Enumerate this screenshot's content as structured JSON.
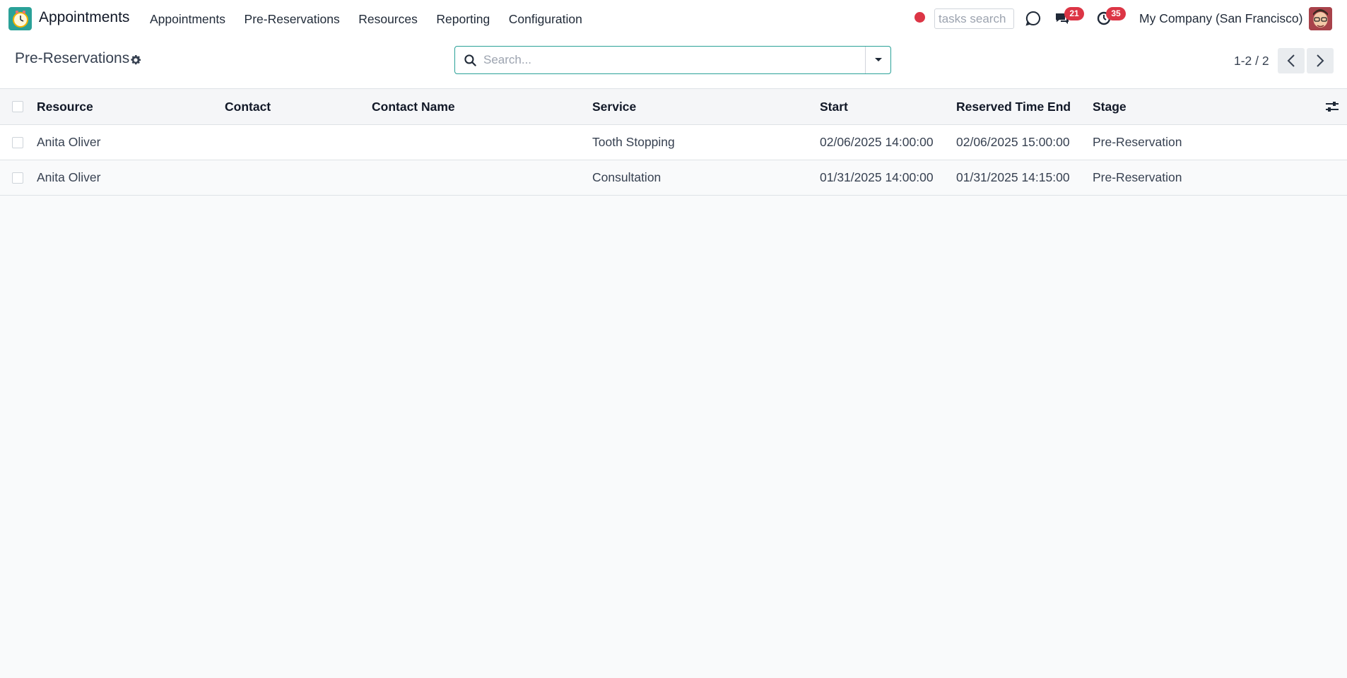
{
  "navbar": {
    "app_name": "Appointments",
    "menu": [
      {
        "label": "Appointments"
      },
      {
        "label": "Pre-Reservations"
      },
      {
        "label": "Resources"
      },
      {
        "label": "Reporting"
      },
      {
        "label": "Configuration"
      }
    ],
    "tasks_search_placeholder": "tasks search",
    "messages_badge": "21",
    "activities_badge": "35",
    "company": "My Company (San Francisco)"
  },
  "control_panel": {
    "breadcrumb": "Pre-Reservations",
    "search_placeholder": "Search...",
    "pager_value": "1-2 / 2"
  },
  "table": {
    "columns": [
      "Resource",
      "Contact",
      "Contact Name",
      "Service",
      "Start",
      "Reserved Time End",
      "Stage"
    ],
    "rows": [
      {
        "resource": "Anita Oliver",
        "contact": "",
        "contact_name": "",
        "service": "Tooth Stopping",
        "start": "02/06/2025 14:00:00",
        "end": "02/06/2025 15:00:00",
        "stage": "Pre-Reservation"
      },
      {
        "resource": "Anita Oliver",
        "contact": "",
        "contact_name": "",
        "service": "Consultation",
        "start": "01/31/2025 14:00:00",
        "end": "01/31/2025 14:15:00",
        "stage": "Pre-Reservation"
      }
    ]
  },
  "colors": {
    "accent": "#2aa198",
    "badge": "#dc3545",
    "background": "#f9fafb"
  },
  "icons": [
    "app-logo-icon",
    "record-dot-icon",
    "chat-bubble-icon",
    "messages-icon",
    "activity-clock-icon",
    "gear-icon",
    "search-icon",
    "caret-down-icon",
    "chevron-left-icon",
    "chevron-right-icon",
    "optional-columns-icon"
  ]
}
